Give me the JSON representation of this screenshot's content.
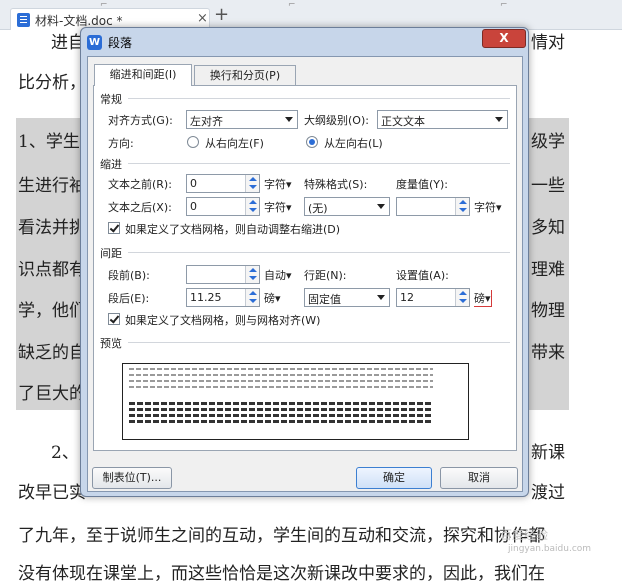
{
  "tabbar": {
    "doc_tab_title": "材料-文档.doc *",
    "close_glyph": "×",
    "new_tab_glyph": "+"
  },
  "document": {
    "lines": [
      {
        "left": "进自",
        "right": "情对"
      },
      {
        "left": "比分析，",
        "right": ""
      },
      {
        "left": "1、学生",
        "right": "级学"
      },
      {
        "left": "生进行袖",
        "right": "一些"
      },
      {
        "left": "看法并挑",
        "right": "多知"
      },
      {
        "left": "识点都有",
        "right": "理难"
      },
      {
        "left": "学，他们",
        "right": "物理"
      },
      {
        "left": "缺乏的自",
        "right": "带来"
      },
      {
        "left": "了巨大的",
        "right": ""
      },
      {
        "left": "2、",
        "right": "新课"
      },
      {
        "left": "改早已实",
        "right": "渡过"
      }
    ],
    "full_line_1": "了九年，至于说师生之间的互动，学生间的互动和交流，探究和协作都",
    "full_line_2": "没有体现在课堂上，而这些恰恰是这次新课改中要求的，因此，我们在",
    "watermark_1": "百度经验",
    "watermark_2": "jingyan.baidu.com"
  },
  "dialog": {
    "logo_letter": "W",
    "title": "段落",
    "close_label": "X",
    "tabs": [
      "缩进和间距(I)",
      "换行和分页(P)"
    ],
    "general": {
      "section": "常规",
      "alignment_label": "对齐方式(G):",
      "alignment_value": "左对齐",
      "outline_label": "大纲级别(O):",
      "outline_value": "正文文本",
      "direction_label": "方向:",
      "rtl_label": "从右向左(F)",
      "ltr_label": "从左向右(L)"
    },
    "indent": {
      "section": "缩进",
      "before_label": "文本之前(R):",
      "before_value": "0",
      "before_unit": "字符▾",
      "after_label": "文本之后(X):",
      "after_value": "0",
      "after_unit": "字符▾",
      "special_label": "特殊格式(S):",
      "special_value": "(无)",
      "measure_label": "度量值(Y):",
      "measure_value": "",
      "measure_unit": "字符▾",
      "auto_adjust_label": "如果定义了文档网格，则自动调整右缩进(D)"
    },
    "spacing": {
      "section": "间距",
      "before_label": "段前(B):",
      "before_value": "",
      "before_unit": "自动▾",
      "after_label": "段后(E):",
      "after_value": "11.25",
      "after_unit": "磅▾",
      "line_label": "行距(N):",
      "line_value": "固定值",
      "set_label": "设置值(A):",
      "set_value": "12",
      "set_unit": "磅▾",
      "snap_grid_label": "如果定义了文档网格，则与网格对齐(W)"
    },
    "preview_label": "预览",
    "buttons": {
      "tabs": "制表位(T)...",
      "ok": "确定",
      "cancel": "取消"
    }
  }
}
